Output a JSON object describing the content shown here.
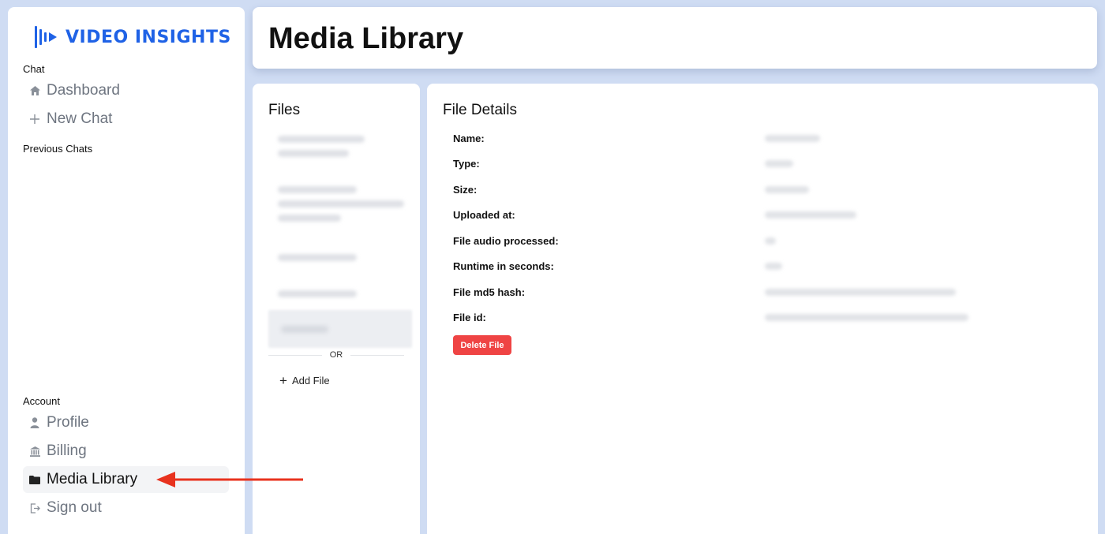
{
  "sidebar": {
    "logo_text": "VIDEO INSIGHTS",
    "chat_section": "Chat",
    "nav_dashboard": "Dashboard",
    "nav_new_chat": "New Chat",
    "previous_chats_section": "Previous Chats",
    "account_section": "Account",
    "nav_profile": "Profile",
    "nav_billing": "Billing",
    "nav_media_library": "Media Library",
    "nav_sign_out": "Sign out",
    "active_item": "Media Library"
  },
  "header": {
    "title": "Media Library"
  },
  "files": {
    "title": "Files",
    "or_label": "OR",
    "add_file_label": "Add File"
  },
  "details": {
    "title": "File Details",
    "labels": {
      "name": "Name:",
      "type": "Type:",
      "size": "Size:",
      "uploaded_at": "Uploaded at:",
      "audio_processed": "File audio processed:",
      "runtime": "Runtime in seconds:",
      "md5": "File md5 hash:",
      "file_id": "File id:"
    },
    "delete_label": "Delete File"
  },
  "colors": {
    "background": "#cfdcf3",
    "brand": "#1f62e6",
    "danger": "#ef4444",
    "annotation_arrow": "#e8321e"
  },
  "icons": [
    "logo-icon",
    "home-icon",
    "plus-icon",
    "user-icon",
    "bank-icon",
    "folder-icon",
    "sign-out-icon",
    "arrow-annotation"
  ]
}
